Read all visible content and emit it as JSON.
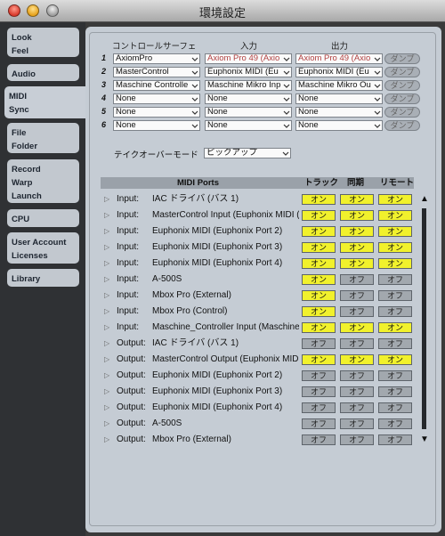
{
  "window": {
    "title": "環境設定"
  },
  "sidebar": {
    "tabs": [
      {
        "lines": [
          "Look",
          "Feel"
        ]
      },
      {
        "lines": [
          "Audio"
        ]
      },
      {
        "lines": [
          "MIDI",
          "Sync"
        ],
        "active": true
      },
      {
        "lines": [
          "File",
          "Folder"
        ]
      },
      {
        "lines": [
          "Record",
          "Warp",
          "Launch"
        ]
      },
      {
        "lines": [
          "CPU"
        ]
      },
      {
        "lines": [
          "User Account",
          "Licenses"
        ]
      },
      {
        "lines": [
          "Library"
        ]
      }
    ]
  },
  "surfaces": {
    "headers": {
      "control_surface": "コントロールサーフェ",
      "input": "入力",
      "output": "出力"
    },
    "dump_label": "ダンプ",
    "rows": [
      {
        "num": "1",
        "surface": "AxiomPro",
        "input": "Axiom Pro 49 (Axio",
        "output": "Axiom Pro 49 (Axio"
      },
      {
        "num": "2",
        "surface": "MasterControl",
        "input": "Euphonix MIDI (Eu",
        "output": "Euphonix MIDI (Eu"
      },
      {
        "num": "3",
        "surface": "Maschine Controlle",
        "input": "Maschine Mikro Inp",
        "output": "Maschine Mikro Ou"
      },
      {
        "num": "4",
        "surface": "None",
        "input": "None",
        "output": "None"
      },
      {
        "num": "5",
        "surface": "None",
        "input": "None",
        "output": "None"
      },
      {
        "num": "6",
        "surface": "None",
        "input": "None",
        "output": "None"
      }
    ]
  },
  "takeover": {
    "label": "テイクオーバーモード",
    "value": "ピックアップ"
  },
  "midi_ports": {
    "headers": {
      "ports": "MIDI Ports",
      "track": "トラック",
      "sync": "同期",
      "remote": "リモート"
    },
    "on_label": "オン",
    "off_label": "オフ",
    "rows": [
      {
        "kind": "Input:",
        "name": "IAC ドライバ (バス 1)",
        "track": true,
        "sync": true,
        "remote": true
      },
      {
        "kind": "Input:",
        "name": "MasterControl Input (Euphonix MIDI (",
        "track": true,
        "sync": true,
        "remote": true
      },
      {
        "kind": "Input:",
        "name": "Euphonix MIDI (Euphonix Port 2)",
        "track": true,
        "sync": true,
        "remote": true
      },
      {
        "kind": "Input:",
        "name": "Euphonix MIDI (Euphonix Port 3)",
        "track": true,
        "sync": true,
        "remote": true
      },
      {
        "kind": "Input:",
        "name": "Euphonix MIDI (Euphonix Port 4)",
        "track": true,
        "sync": true,
        "remote": true
      },
      {
        "kind": "Input:",
        "name": "A-500S",
        "track": true,
        "sync": false,
        "remote": false
      },
      {
        "kind": "Input:",
        "name": "Mbox Pro (External)",
        "track": true,
        "sync": false,
        "remote": false
      },
      {
        "kind": "Input:",
        "name": "Mbox Pro (Control)",
        "track": true,
        "sync": false,
        "remote": false
      },
      {
        "kind": "Input:",
        "name": "Maschine_Controller Input (Maschine",
        "track": true,
        "sync": true,
        "remote": true
      },
      {
        "kind": "Output:",
        "name": "IAC ドライバ (バス 1)",
        "track": false,
        "sync": false,
        "remote": false
      },
      {
        "kind": "Output:",
        "name": "MasterControl Output (Euphonix MID",
        "track": true,
        "sync": true,
        "remote": true
      },
      {
        "kind": "Output:",
        "name": "Euphonix MIDI (Euphonix Port 2)",
        "track": false,
        "sync": false,
        "remote": false
      },
      {
        "kind": "Output:",
        "name": "Euphonix MIDI (Euphonix Port 3)",
        "track": false,
        "sync": false,
        "remote": false
      },
      {
        "kind": "Output:",
        "name": "Euphonix MIDI (Euphonix Port 4)",
        "track": false,
        "sync": false,
        "remote": false
      },
      {
        "kind": "Output:",
        "name": "A-500S",
        "track": false,
        "sync": false,
        "remote": false
      },
      {
        "kind": "Output:",
        "name": "Mbox Pro (External)",
        "track": false,
        "sync": false,
        "remote": false
      }
    ]
  },
  "colors": {
    "on": "#f1f12c",
    "off": "#a2a8ae",
    "panel": "#c5ccd4",
    "sidebar": "#2f3134"
  }
}
